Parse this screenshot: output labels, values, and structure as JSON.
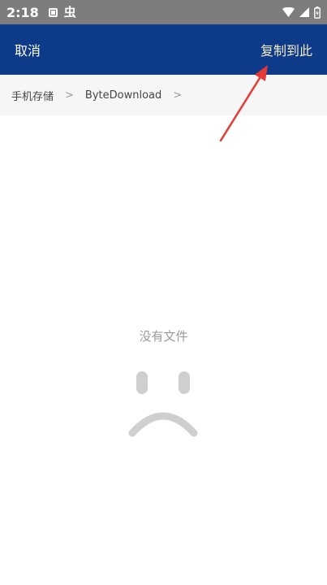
{
  "status_bar": {
    "time": "2:18",
    "left_icons": [
      "notification-box-icon",
      "bug-icon"
    ],
    "bug_glyph": "虫",
    "right_icons": [
      "wifi-icon",
      "signal-icon",
      "battery-icon"
    ]
  },
  "appbar": {
    "cancel_label": "取消",
    "copy_here_label": "复制到此",
    "background_color": "#0e3a8a",
    "copy_here_color": "#f2ecc6"
  },
  "breadcrumb": {
    "items": [
      {
        "label": "手机存储"
      },
      {
        "label": "ByteDownload"
      }
    ],
    "separator": ">"
  },
  "empty_state": {
    "message": "没有文件",
    "icon": "sad-face-icon"
  },
  "annotation": {
    "type": "red-arrow",
    "target": "copy-here-button",
    "color": "#e53935"
  }
}
